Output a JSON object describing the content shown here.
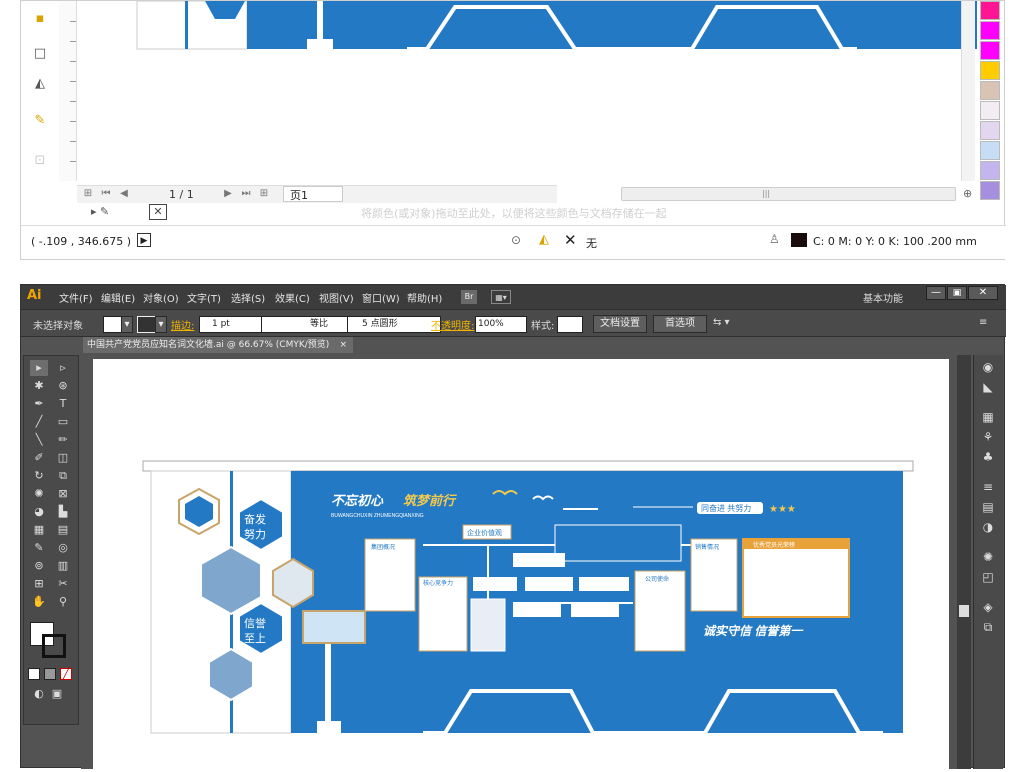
{
  "top_window": {
    "page_counter": "1 / 1",
    "page_tab": "页1",
    "drop_hint": "将颜色(或对象)拖动至此处，以便将这些颜色与文档存储在一起",
    "cursor_coords": "( -.109 , 346.675 )",
    "fill_none": "无",
    "color_info": "C: 0 M: 0 Y: 0 K: 100  .200 mm",
    "palette": [
      "#ff1493",
      "#ff00ff",
      "#ffe600",
      "#ffcc00",
      "#d9c3b5",
      "#f3ecf3",
      "#e3d7f0",
      "#c7ddf5",
      "#c4b5ee",
      "#a78fe0"
    ]
  },
  "ai_window": {
    "app_logo": "Ai",
    "menus": [
      "文件(F)",
      "编辑(E)",
      "对象(O)",
      "文字(T)",
      "选择(S)",
      "效果(C)",
      "视图(V)",
      "窗口(W)",
      "帮助(H)"
    ],
    "bridge_btn": "Br",
    "workspace": "基本功能",
    "control": {
      "selection_label": "未选择对象",
      "stroke_label": "描边:",
      "stroke_value": "1 pt",
      "profile": "等比",
      "brush": "5 点圆形",
      "opacity_label": "不透明度:",
      "opacity_value": "100%",
      "style_label": "样式:",
      "doc_setup": "文档设置",
      "prefs": "首选项"
    },
    "tab_title": "中国共产党党员应知名词文化墙.ai @ 66.67% (CMYK/预览)",
    "tab_close": "×"
  },
  "artwork": {
    "slogan_a": "不忘初心",
    "slogan_b": "筑梦前行",
    "slogan_pinyin": "BUWANGCHUXIN ZHUMENGQIANXING",
    "hex_1": "奋发努力",
    "hex_2": "信誉至上",
    "motto_right": "同奋进  共努力",
    "bottom_slogan": "诚实守信    信誉第一",
    "box_values": "企业价值观",
    "box_overview": "集团概况",
    "box_core": "核心竞争力",
    "box_sales": "销售情况",
    "box_company": "公司使命",
    "box_honor": "优秀党员光荣榜",
    "values_items": [
      "诚实守信",
      "客户至上",
      "积极进取",
      "勇敢责任",
      "团结合作",
      "业绩为王"
    ],
    "palette_colors": {
      "wall_blue": "#2479c4",
      "gold": "#c9a46a",
      "orange": "#e8a23a"
    }
  }
}
